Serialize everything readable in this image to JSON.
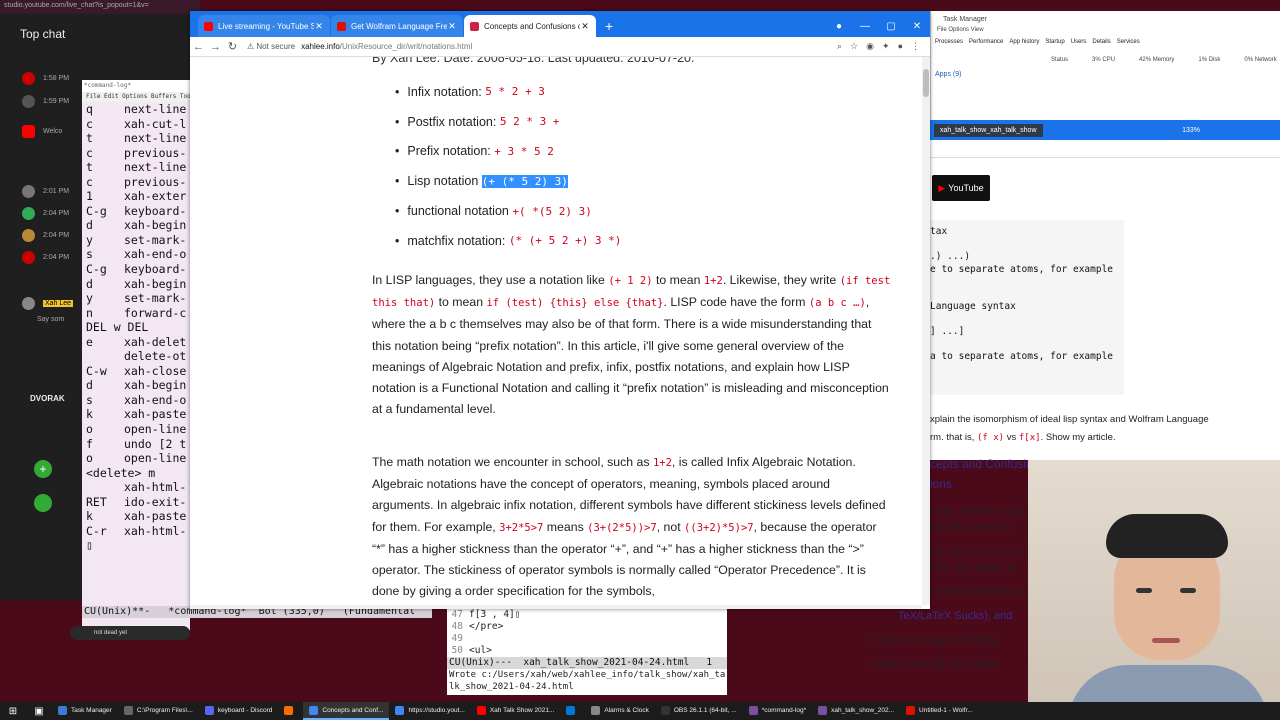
{
  "yt_chat": {
    "url": "studio.youtube.com/live_chat?is_popout=1&v=",
    "header": "Top chat",
    "times": [
      "1:58 PM",
      "1:59 PM",
      "2:01 PM",
      "2:04 PM",
      "2:04 PM",
      "2:04 PM"
    ],
    "notice": "Welco",
    "highlight_user": "Xah Lee",
    "preview": "Say som",
    "side_labels": [
      "DVORAK"
    ]
  },
  "emacs_log": {
    "title": "*command-log*",
    "menu": "File  Edit  Options  Buffers  Tools",
    "rows": [
      {
        "k": "q",
        "c": "next-line"
      },
      {
        "k": "c",
        "c": "xah-cut-l"
      },
      {
        "k": "t",
        "c": "next-line"
      },
      {
        "k": "c",
        "c": "previous-"
      },
      {
        "k": "t",
        "c": "next-line"
      },
      {
        "k": "c",
        "c": "previous-"
      },
      {
        "k": "1",
        "c": "xah-exter"
      },
      {
        "k": "C-g",
        "c": "keyboard-"
      },
      {
        "k": "d",
        "c": "xah-begin"
      },
      {
        "k": "y",
        "c": "set-mark-"
      },
      {
        "k": "s",
        "c": "xah-end-o"
      },
      {
        "k": "C-g",
        "c": "keyboard-"
      },
      {
        "k": "d",
        "c": "xah-begin"
      },
      {
        "k": "y",
        "c": "set-mark-"
      },
      {
        "k": "n",
        "c": "forward-c"
      },
      {
        "k": "DEL w DEL",
        "c": ""
      },
      {
        "k": "e",
        "c": "xah-delet"
      },
      {
        "k": "",
        "c": "delete-ot"
      },
      {
        "k": "C-w",
        "c": "xah-close"
      },
      {
        "k": "d",
        "c": "xah-begin"
      },
      {
        "k": "s",
        "c": "xah-end-o"
      },
      {
        "k": "k",
        "c": "xah-paste"
      },
      {
        "k": "o",
        "c": "open-line"
      },
      {
        "k": "f",
        "c": "undo [2 t"
      },
      {
        "k": "o",
        "c": "open-line"
      },
      {
        "k": "<delete> m",
        "c": ""
      },
      {
        "k": "",
        "c": "xah-html-"
      },
      {
        "k": "RET",
        "c": "ido-exit-"
      },
      {
        "k": "k",
        "c": "xah-paste"
      },
      {
        "k": "C-r",
        "c": "xah-html-"
      },
      {
        "k": "▯",
        "c": ""
      }
    ],
    "modeline": "CU(Unix)**-   *command-log*  Bot (335,0)   (Fundamental"
  },
  "browser": {
    "tabs": [
      {
        "label": "Live streaming - YouTube Studio",
        "color": "#ff0000",
        "active": false
      },
      {
        "label": "Get Wolfram Language Free",
        "color": "#dd1100",
        "active": false
      },
      {
        "label": "Concepts and Confusions of Pre",
        "color": "#cc2244",
        "active": true
      }
    ],
    "new_tab": "+",
    "security": "Not secure",
    "domain": "xahlee.info",
    "path": "/UnixResource_dir/writ/notations.html"
  },
  "page": {
    "byline": "By Xah Lee. Date: 2008-05-18. Last updated: 2010-07-20.",
    "notations": [
      {
        "label": "Infix notation:",
        "code": "5 * 2 + 3",
        "highlight": false
      },
      {
        "label": "Postfix notation:",
        "code": "5 2 * 3 +",
        "highlight": false
      },
      {
        "label": "Prefix notation:",
        "code": "+ 3 * 5 2",
        "highlight": false
      },
      {
        "label": "Lisp notation",
        "code": "(+ (* 5 2) 3)",
        "highlight": true
      },
      {
        "label": "functional notation",
        "code": "+( *(5 2) 3)",
        "highlight": false
      },
      {
        "label": "matchfix notation:",
        "code": "(* (+ 5 2 +) 3 *)",
        "highlight": false
      }
    ],
    "p1": {
      "t1": "In LISP languages, they use a notation like ",
      "c1": "(+ 1 2)",
      "t2": " to mean ",
      "c2": "1+2",
      "t3": ". Likewise, they write ",
      "c3": "(if test this that)",
      "t4": " to mean ",
      "c4": "if (test) {this} else {that}",
      "t5": ". LISP code have the form ",
      "c5": "(a b c …)",
      "t6": ", where the a b c themselves may also be of that form. There is a wide misunderstanding that this notation being “prefix notation”. In this article, i'll give some general overview of the meanings of Algebraic Notation and prefix, infix, postfix notations, and explain how LISP notation is a Functional Notation and calling it “prefix notation” is misleading and misconception at a fundamental level."
    },
    "p2": {
      "t1": "The math notation we encounter in school, such as ",
      "c1": "1+2",
      "t2": ", is called Infix Algebraic Notation. Algebraic notations have the concept of operators, meaning, symbols placed around arguments. In algebraic infix notation, different symbols have different stickiness levels defined for them. For example, ",
      "c2": "3+2*5>7",
      "t3": " means ",
      "c3": "(3+(2*5))>7",
      "t4": ", not ",
      "c4": "((3+2)*5)>7",
      "t5": ", because the operator “*” has a higher stickness than the operator “+”, and “+” has a higher stickness than the “>” operator. The stickiness of operator symbols is normally called “Operator Precedence”. It is done by giving a order specification for the symbols,"
    }
  },
  "taskmgr": {
    "title": "Task Manager",
    "menu": "File  Options  View",
    "tabs": [
      "Processes",
      "Performance",
      "App history",
      "Startup",
      "Users",
      "Details",
      "Services"
    ],
    "cols": [
      "Status",
      "3% CPU",
      "42% Memory",
      "1% Disk",
      "0% Network"
    ],
    "apps": "Apps (9)"
  },
  "right_win": {
    "tab": "xah_talk_show_xah_talk_show",
    "zoom": "133%",
    "youtube": "YouTube",
    "code_lines": [
      "tax",
      "",
      ".) ...)",
      "e to separate atoms, for example",
      "",
      "",
      "Language syntax",
      "",
      "] ...]",
      "",
      "a to separate atoms, for example"
    ],
    "text1": "xplain the isomorphism of ideal lisp syntax and Wolfram Language",
    "text2a": "rm. that is, ",
    "text2c1": "(f x)",
    "text2b": " vs ",
    "text2c2": "f[x]",
    "text2d": ". Show my article.",
    "head1": "cepts and Confusions of Prefix, Infix, Postfix and Lisp",
    "head2": "ions",
    "frag1": "n fully, Wolfram Langu",
    "frag2": "ymbolic expression (",
    "frag3": "asy. Show 1+1, 2*3, L",
    "frag4": "refix, infix, postfix, ar",
    "frag5": "n some typesetting. Sh",
    "link": "TeX/LaTeX Sucks), and",
    "bullets": [
      "show some org mode featu",
      "show some org mode featu"
    ]
  },
  "emacs_bottom": {
    "lines": [
      {
        "n": "47",
        "t": "f[3 , 4]▯"
      },
      {
        "n": "48",
        "t": "</pre>"
      },
      {
        "n": "49",
        "t": ""
      },
      {
        "n": "50",
        "t": "<ul>"
      }
    ],
    "modeline": "CU(Unix)---  xah_talk_show_2021-04-24.html   1",
    "echo": "Wrote c:/Users/xah/web/xahlee_info/talk_show/xah_talk_show_2021-04-24.html"
  },
  "taskbar": {
    "items": [
      {
        "label": "Task Manager",
        "color": "#3a7bd5",
        "active": false
      },
      {
        "label": "C:\\Program Files\\...",
        "color": "#666",
        "active": false
      },
      {
        "label": "keyboard - Discord",
        "color": "#5865f2",
        "active": false
      },
      {
        "label": "",
        "color": "#ff6b00",
        "active": false
      },
      {
        "label": "Concepts and Conf...",
        "color": "#4285f4",
        "active": true
      },
      {
        "label": "https://studio.yout...",
        "color": "#4285f4",
        "active": false
      },
      {
        "label": "Xah Talk Show 2021...",
        "color": "#ff0000",
        "active": false
      },
      {
        "label": "",
        "color": "#0078d7",
        "active": false
      },
      {
        "label": "Alarms & Clock",
        "color": "#888",
        "active": false
      },
      {
        "label": "OBS 26.1.1 (64-bit, ...",
        "color": "#333",
        "active": false
      },
      {
        "label": "*command-log*",
        "color": "#7b4fa0",
        "active": false
      },
      {
        "label": "xah_talk_show_202...",
        "color": "#7b4fa0",
        "active": false
      },
      {
        "label": "Untitled-1 - Wolfr...",
        "color": "#dd1100",
        "active": false
      }
    ]
  },
  "webcam_caption": "not dead yet"
}
